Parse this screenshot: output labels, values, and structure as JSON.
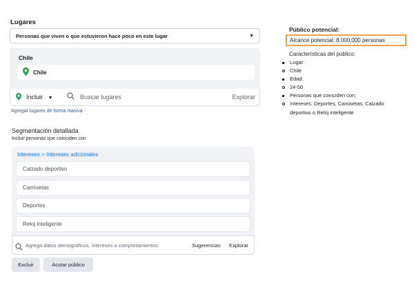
{
  "locations": {
    "title": "Lugares",
    "dropdown_value": "Personas que viven o que estuvieron hace poco en este lugar",
    "country_heading": "Chile",
    "selected_location": "Chile",
    "include_label": "Incluir",
    "search_placeholder": "Buscar lugares",
    "explore_label": "Explorar",
    "bulk_link": "Agregar lugares de forma masiva"
  },
  "detailed_targeting": {
    "title": "Segmentación detallada",
    "subtitle": "Incluir personas que coinciden con",
    "breadcrumb_root": "Intereses",
    "breadcrumb_sep": " > ",
    "breadcrumb_child": "Intereses adicionales",
    "interests": [
      "Calzado deportivo",
      "Camisetas",
      "Deportes",
      "Reloj inteligente"
    ],
    "search_placeholder": "Agrega datos demográficos, intereses o comportamientos",
    "suggestions_label": "Sugerencias",
    "explore_label": "Explorar",
    "exclude_button": "Excluir",
    "narrow_button": "Acotar público"
  },
  "audience": {
    "title": "Público potencial:",
    "reach": "Alcance potencial: 8.000.000 personas",
    "characteristics_title": "Características del público:",
    "items": [
      {
        "text": "Lugar:",
        "level": 1
      },
      {
        "text": "Chile",
        "level": 2
      },
      {
        "text": "Edad:",
        "level": 1
      },
      {
        "text": "24-50",
        "level": 2
      },
      {
        "text": "Personas que coinciden con:",
        "level": 1
      },
      {
        "text": "Intereses: Deportes, Camisetas, Calzado deportivo o Reloj inteligente",
        "level": 2
      }
    ]
  },
  "colors": {
    "highlight_border": "#f0a04b",
    "pin_green": "#31a24c",
    "link_blue": "#1877f2"
  }
}
